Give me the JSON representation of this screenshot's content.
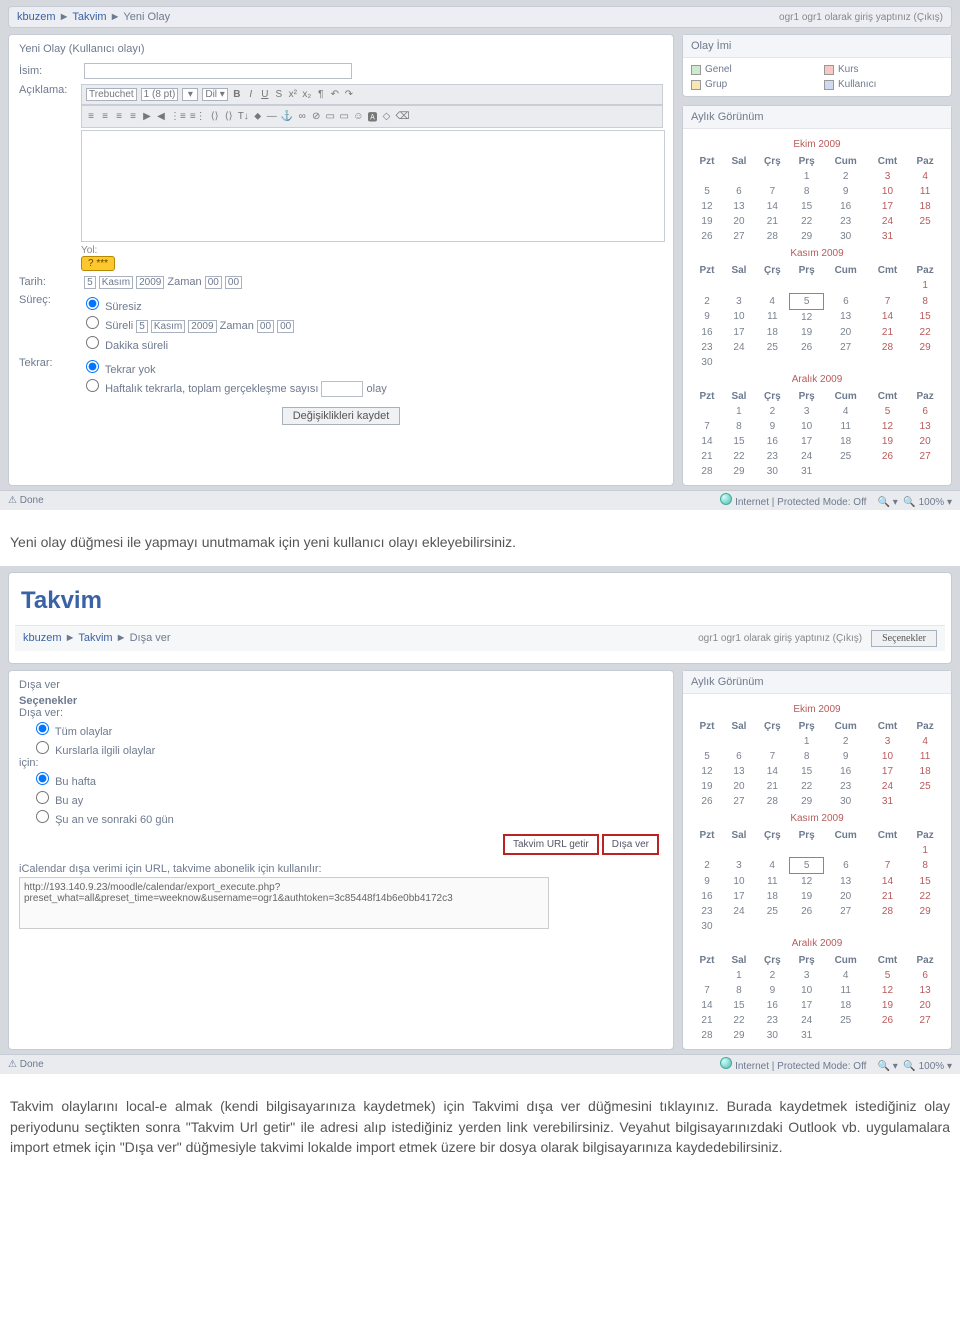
{
  "doc": {
    "para1": "Yeni olay düğmesi ile yapmayı unutmamak için yeni kullanıcı olayı ekleyebilirsiniz.",
    "para2": "Takvim olaylarını local-e almak (kendi bilgisayarınıza kaydetmek) için Takvimi dışa ver düğmesini tıklayınız. Burada kaydetmek istediğiniz olay periyodunu seçtikten sonra \"Takvim Url getir\" ile adresi alıp istediğiniz yerden link verebilirsiniz. Veyahut bilgisayarınızdaki Outlook vb. uygulamalara import etmek için \"Dışa ver\" düğmesiyle takvimi lokalde import etmek üzere bir dosya olarak bilgisayarınıza kaydedebilirsiniz."
  },
  "bc1": {
    "a": "kbuzem",
    "b": "Takvim",
    "c": "Yeni Olay",
    "login": "ogr1 ogr1 olarak giriş yaptınız (Çıkış)"
  },
  "bc2": {
    "a": "kbuzem",
    "b": "Takvim",
    "c": "Dışa ver",
    "login": "ogr1 ogr1 olarak giriş yaptınız (Çıkış)",
    "opts": "Seçenekler"
  },
  "form": {
    "title": "Yeni Olay (Kullanıcı olayı)",
    "isim": "İsim:",
    "aciklama": "Açıklama:",
    "font": "Trebuchet",
    "size": "1 (8 pt)",
    "yol": "Yol:",
    "yolbtn": "? ***",
    "tarih": "Tarih:",
    "day": "5",
    "month": "Kasım",
    "year": "2009",
    "zaman": "Zaman",
    "h": "00",
    "m": "00",
    "surec": "Süreç:",
    "s1": "Süresiz",
    "s2": "Süreli",
    "s3": "Dakika süreli",
    "tekrar": "Tekrar:",
    "t1": "Tekrar yok",
    "t2": "Haftalık tekrarla, toplam gerçekleşme sayısı",
    "olay": "olay",
    "save": "Değişiklikleri kaydet"
  },
  "export": {
    "title": "Dışa ver",
    "sec": "Seçenekler",
    "dv": "Dışa ver:",
    "o1": "Tüm olaylar",
    "o2": "Kurslarla ilgili olaylar",
    "icin": "için:",
    "r1": "Bu hafta",
    "r2": "Bu ay",
    "r3": "Şu an ve sonraki 60 gün",
    "b1": "Takvim URL getir",
    "b2": "Dışa ver",
    "ical": "iCalendar dışa verimi için URL, takvime abonelik için kullanılır:",
    "url": "http://193.140.9.23/moodle/calendar/export_execute.php?preset_what=all&preset_time=weeknow&username=ogr1&authtoken=3c85448f14b6e0bb4172c3"
  },
  "key": {
    "title": "Olay İmi",
    "a": "Genel",
    "b": "Kurs",
    "c": "Grup",
    "d": "Kullanıcı"
  },
  "cal": {
    "title": "Aylık Görünüm",
    "hd": [
      "Pzt",
      "Sal",
      "Çrş",
      "Prş",
      "Cum",
      "Cmt",
      "Paz"
    ],
    "m1": {
      "name": "Ekim 2009",
      "start": 3,
      "days": 31
    },
    "m2": {
      "name": "Kasım 2009",
      "start": 6,
      "days": 30,
      "today": 5
    },
    "m3": {
      "name": "Aralık 2009",
      "start": 1,
      "days": 31
    }
  },
  "status": {
    "done": "Done",
    "mode": "Internet | Protected Mode: Off",
    "zoom": "100%"
  },
  "headline": "Takvim"
}
